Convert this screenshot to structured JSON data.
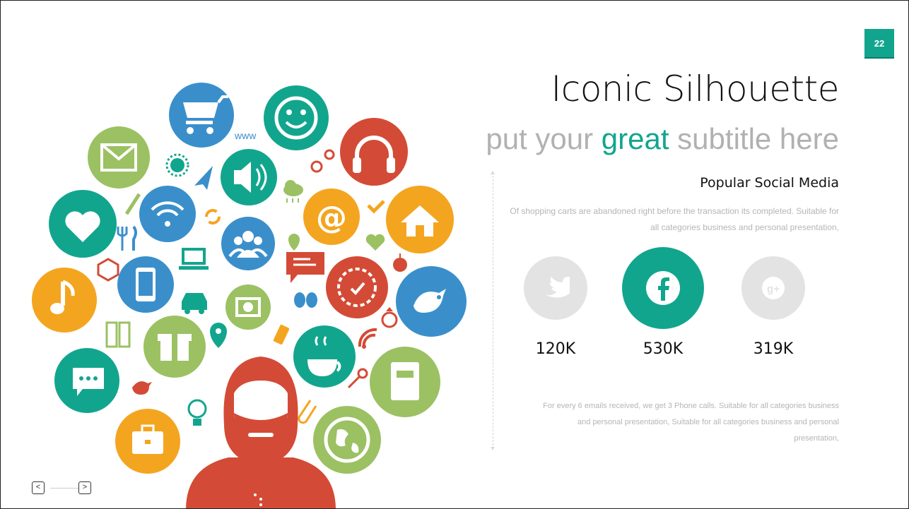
{
  "slide": {
    "page_number": "22",
    "title": "Iconic Silhouette",
    "subtitle": {
      "prefix": "put your ",
      "highlight": "great",
      "suffix": " subtitle here"
    },
    "section_title": "Popular Social Media",
    "description_1": "Of shopping carts are abandoned right before the transaction its completed. Suitable for all categories business and personal presentation,",
    "stats": [
      {
        "icon": "twitter-icon",
        "value": "120K",
        "color": "#e3e3e3"
      },
      {
        "icon": "facebook-icon",
        "value": "530K",
        "color": "#12a58e"
      },
      {
        "icon": "google-plus-icon",
        "value": "319K",
        "color": "#e3e3e3"
      }
    ],
    "description_2": "For every 6 emails received, we get 3 Phone calls. Suitable for all categories business and personal presentation, Suitable for all categories business and personal presentation,",
    "artwork": {
      "www_text": "www"
    },
    "nav": {
      "prev": "<",
      "next": ">"
    }
  },
  "colors": {
    "teal": "#12a58e",
    "blue": "#3a8fcb",
    "green": "#9bc163",
    "orange": "#f4a51f",
    "red": "#d34b36"
  }
}
